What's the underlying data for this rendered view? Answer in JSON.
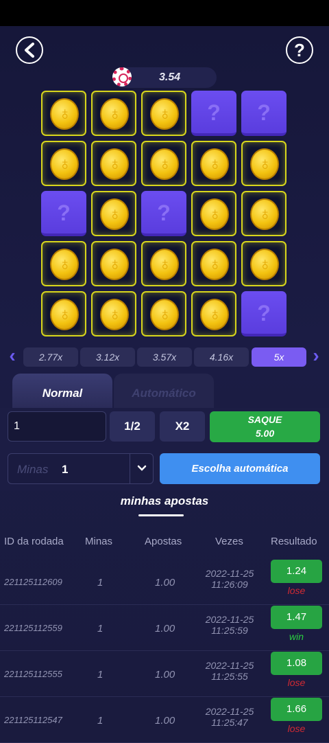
{
  "header": {
    "back_icon": "chevron-left-icon",
    "help_label": "?"
  },
  "balance": {
    "value": "3.54",
    "icon": "poker-chip-icon"
  },
  "grid": [
    [
      "coin",
      "coin",
      "coin",
      "hidden",
      "hidden"
    ],
    [
      "coin",
      "coin",
      "coin",
      "coin",
      "coin"
    ],
    [
      "hidden",
      "coin",
      "hidden",
      "coin",
      "coin"
    ],
    [
      "coin",
      "coin",
      "coin",
      "coin",
      "coin"
    ],
    [
      "coin",
      "coin",
      "coin",
      "coin",
      "hidden"
    ]
  ],
  "hidden_label": "?",
  "multipliers": [
    "2.77x",
    "3.12x",
    "3.57x",
    "4.16x",
    "5x"
  ],
  "active_multiplier": "5x",
  "tabs": {
    "normal": "Normal",
    "auto": "Automático"
  },
  "bet": {
    "amount": "1",
    "half": "1/2",
    "double": "X2"
  },
  "cashout": {
    "label": "SAQUE",
    "value": "5.00"
  },
  "mines": {
    "label": "Minas",
    "value": "1"
  },
  "auto_pick": "Escolha automática",
  "section_title": "minhas apostas",
  "table": {
    "headers": [
      "ID da rodada",
      "Minas",
      "Apostas",
      "Vezes",
      "Resultado"
    ],
    "rows": [
      {
        "id": "221125112609",
        "mines": "1",
        "bet": "1.00",
        "date": "2022-11-25",
        "time": "11:26:09",
        "mult": "1.24",
        "result": "lose"
      },
      {
        "id": "221125112559",
        "mines": "1",
        "bet": "1.00",
        "date": "2022-11-25",
        "time": "11:25:59",
        "mult": "1.47",
        "result": "win"
      },
      {
        "id": "221125112555",
        "mines": "1",
        "bet": "1.00",
        "date": "2022-11-25",
        "time": "11:25:55",
        "mult": "1.08",
        "result": "lose"
      },
      {
        "id": "221125112547",
        "mines": "1",
        "bet": "1.00",
        "date": "2022-11-25",
        "time": "11:25:47",
        "mult": "1.66",
        "result": "lose"
      }
    ]
  },
  "colors": {
    "accent": "#7a5cf2",
    "gold": "#d8d61c",
    "green": "#28a945",
    "blue": "#3f8ff0",
    "lose": "#d12a33",
    "win": "#2ad040"
  }
}
